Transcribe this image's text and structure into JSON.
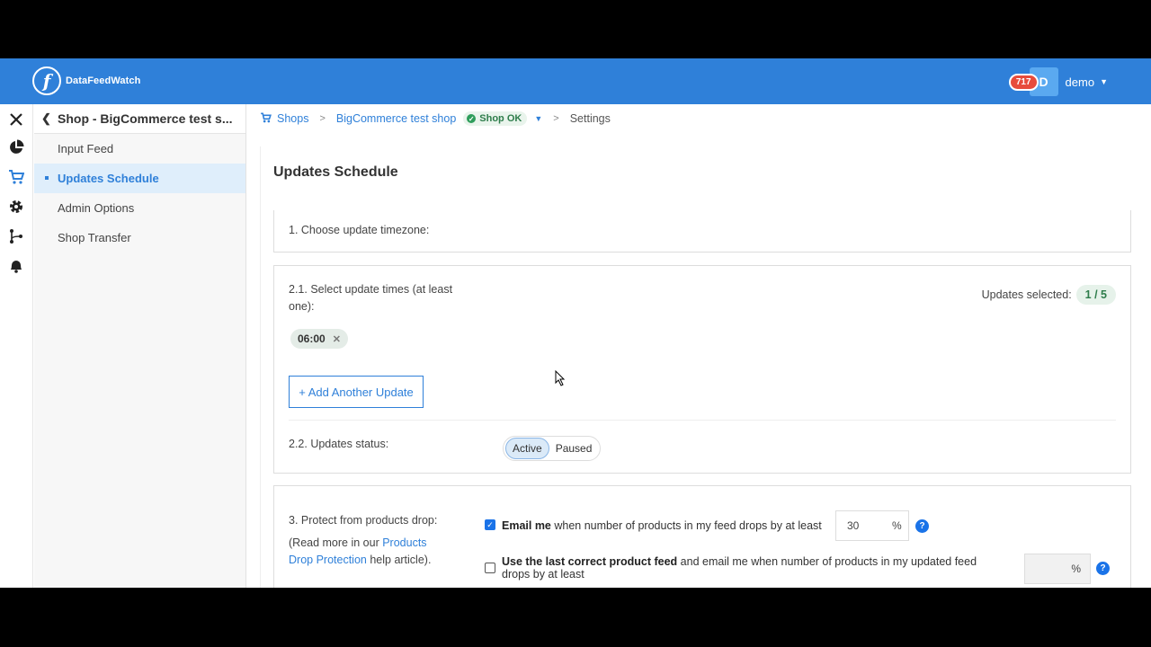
{
  "app": {
    "brand": "DataFeedWatch",
    "logo_glyph": "f",
    "notification_count": "717",
    "avatar_initial": "D",
    "username": "demo",
    "brand_color": "#2f80d9"
  },
  "rail": {
    "icons": [
      "close-icon",
      "pie-chart-icon",
      "cart-icon",
      "gear-icon",
      "branch-icon",
      "bell-icon"
    ],
    "help_glyph": "?"
  },
  "sidebar": {
    "title": "Shop - BigCommerce test s...",
    "items": [
      {
        "label": "Input Feed"
      },
      {
        "label": "Updates Schedule",
        "active": true
      },
      {
        "label": "Admin Options"
      },
      {
        "label": "Shop Transfer"
      }
    ]
  },
  "breadcrumb": {
    "shops": "Shops",
    "shop_name": "BigCommerce test shop",
    "status": "Shop OK",
    "current": "Settings"
  },
  "main": {
    "title": "Updates Schedule",
    "step1_label": "1. Choose update timezone:",
    "step21_label": "2.1. Select update times (at least one):",
    "updates_selected_label": "Updates selected:",
    "updates_selected_value": "1 / 5",
    "times": [
      "06:00"
    ],
    "add_button": "+ Add Another Update",
    "step22_label": "2.2. Updates status:",
    "status_options": [
      "Active",
      "Paused"
    ],
    "status_selected": "Active",
    "step3_label": "3. Protect from products drop:",
    "step3_help_pre": "(Read more in our ",
    "step3_help_link": "Products Drop Protection",
    "step3_help_post": " help article).",
    "option1": {
      "checked": true,
      "bold": "Email me",
      "text": " when number of products in my feed drops by at least",
      "value": "30",
      "unit": "%"
    },
    "option2": {
      "checked": false,
      "bold1": "Use the last correct product feed",
      "text1": " and email me",
      "text2": " when number of products in my updated feed drops by at least",
      "value": "",
      "unit": "%"
    }
  }
}
